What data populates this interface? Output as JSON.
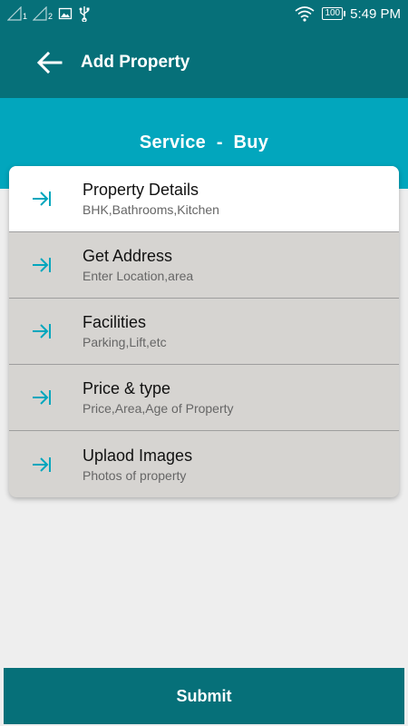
{
  "status_bar": {
    "sim1_label": "1",
    "sim2_label": "2",
    "battery": "100",
    "time": "5:49 PM"
  },
  "app_bar": {
    "title": "Add Property"
  },
  "header": {
    "title": "Service  -  Buy"
  },
  "items": [
    {
      "title": "Property Details",
      "subtitle": "BHK,Bathrooms,Kitchen"
    },
    {
      "title": "Get Address",
      "subtitle": "Enter Location,area"
    },
    {
      "title": "Facilities",
      "subtitle": "Parking,Lift,etc"
    },
    {
      "title": "Price & type",
      "subtitle": "Price,Area,Age of Property"
    },
    {
      "title": "Uplaod Images",
      "subtitle": "Photos of property"
    }
  ],
  "submit_label": "Submit",
  "colors": {
    "primary_dark": "#067079",
    "accent": "#02a6bd",
    "list_bg": "#d6d4d1",
    "page_bg": "#eeeeee"
  }
}
